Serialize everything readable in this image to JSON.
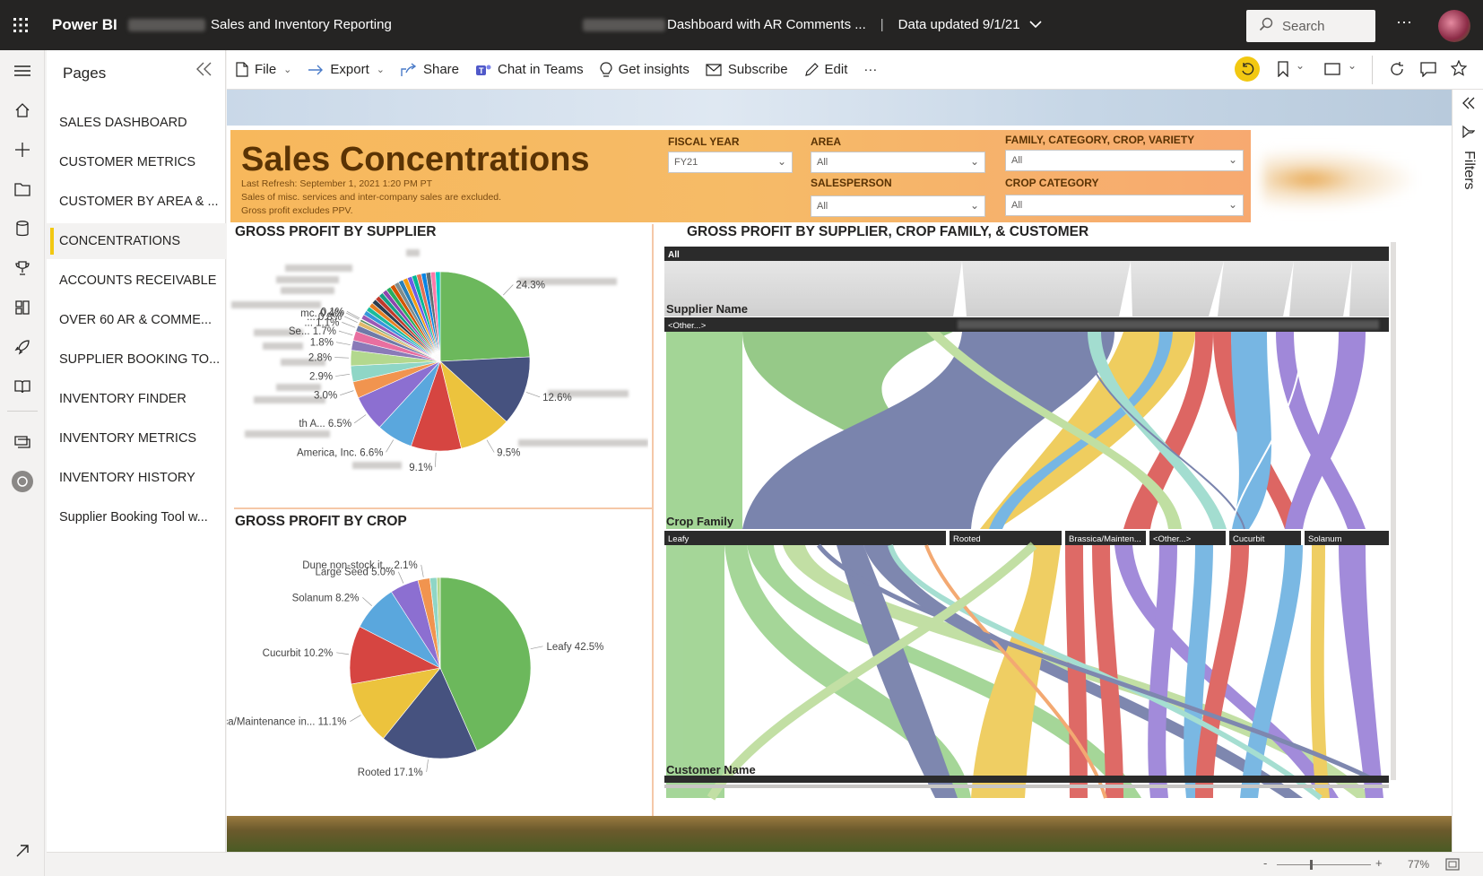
{
  "topbar": {
    "brand": "Power BI",
    "workspace": "Sales and Inventory Reporting",
    "report": "Dashboard with AR Comments ...",
    "separator": "|",
    "data_updated": "Data updated 9/1/21",
    "search_placeholder": "Search",
    "more": "···"
  },
  "pages_panel": {
    "title": "Pages",
    "items": [
      {
        "label": "SALES DASHBOARD",
        "active": false
      },
      {
        "label": "CUSTOMER METRICS",
        "active": false
      },
      {
        "label": "CUSTOMER BY AREA & ...",
        "active": false
      },
      {
        "label": "CONCENTRATIONS",
        "active": true
      },
      {
        "label": "ACCOUNTS RECEIVABLE",
        "active": false
      },
      {
        "label": "OVER 60 AR & COMME...",
        "active": false
      },
      {
        "label": "SUPPLIER BOOKING TO...",
        "active": false
      },
      {
        "label": "INVENTORY FINDER",
        "active": false
      },
      {
        "label": "INVENTORY METRICS",
        "active": false
      },
      {
        "label": "INVENTORY HISTORY",
        "active": false
      },
      {
        "label": "Supplier Booking Tool w...",
        "active": false
      }
    ]
  },
  "actionbar": {
    "file": "File",
    "export": "Export",
    "share": "Share",
    "chat": "Chat in Teams",
    "insights": "Get insights",
    "subscribe": "Subscribe",
    "edit": "Edit",
    "more": "···"
  },
  "report_header": {
    "title": "Sales Concentrations",
    "last_refresh": "Last Refresh: September 1, 2021 1:20 PM PT",
    "note1": "Sales of misc. services and inter-company sales are excluded.",
    "note2": "Gross profit excludes PPV."
  },
  "filters": {
    "fiscal_year_label": "FISCAL YEAR",
    "fiscal_year_value": "FY21",
    "area_label": "AREA",
    "area_value": "All",
    "salesperson_label": "SALESPERSON",
    "salesperson_value": "All",
    "family_label": "FAMILY, CATEGORY, CROP, VARIETY",
    "family_value": "All",
    "crop_category_label": "CROP CATEGORY",
    "crop_category_value": "All"
  },
  "visual_titles": {
    "by_supplier": "GROSS PROFIT BY SUPPLIER",
    "by_crop": "GROSS PROFIT BY CROP",
    "decomposition": "GROSS PROFIT BY SUPPLIER, CROP FAMILY, & CUSTOMER"
  },
  "chart_data": [
    {
      "type": "pie",
      "title": "GROSS PROFIT BY SUPPLIER",
      "slices": [
        {
          "label": "",
          "value": 24.3,
          "color": "#6cb85c"
        },
        {
          "label": "",
          "value": 12.6,
          "color": "#46527f"
        },
        {
          "label": "",
          "value": 9.5,
          "color": "#ecc33d"
        },
        {
          "label": "",
          "value": 9.1,
          "color": "#d64541"
        },
        {
          "label": "America, Inc.",
          "value": 6.6,
          "color": "#5aa7dd"
        },
        {
          "label": "th A...",
          "value": 6.5,
          "color": "#8c6fd1"
        },
        {
          "label": "",
          "value": 3.0,
          "color": "#f1944f"
        },
        {
          "label": "",
          "value": 2.9,
          "color": "#8fd6c6"
        },
        {
          "label": "",
          "value": 2.8,
          "color": "#b3d88e"
        },
        {
          "label": "",
          "value": 1.8,
          "color": "#8a7ab8"
        },
        {
          "label": "Se...",
          "value": 1.7,
          "color": "#e86fa0"
        },
        {
          "label": "...",
          "value": 1.1,
          "color": "#6f7aa8"
        },
        {
          "label": "...",
          "value": 0.8,
          "color": "#e2b96a"
        },
        {
          "label": "mc.",
          "value": 0.4,
          "color": "#5b8f61"
        },
        {
          "label": "",
          "value": 0.1,
          "color": "#a04560"
        }
      ],
      "other_value": 17.2
    },
    {
      "type": "pie",
      "title": "GROSS PROFIT BY CROP",
      "slices": [
        {
          "label": "Leafy",
          "value": 42.5,
          "color": "#6cb85c"
        },
        {
          "label": "Rooted",
          "value": 17.1,
          "color": "#46527f"
        },
        {
          "label": "Brassica/Maintenance in...",
          "value": 11.1,
          "color": "#ecc33d"
        },
        {
          "label": "Cucurbit",
          "value": 10.2,
          "color": "#d64541"
        },
        {
          "label": "Solanum",
          "value": 8.2,
          "color": "#5aa7dd"
        },
        {
          "label": "Large Seed",
          "value": 5.0,
          "color": "#8c6fd1"
        },
        {
          "label": "Dune non-stock it...",
          "value": 2.1,
          "color": "#f1944f"
        },
        {
          "label": "",
          "value": 1.2,
          "color": "#8fd6c6"
        },
        {
          "label": "",
          "value": 0.6,
          "color": "#b3d88e"
        }
      ]
    }
  ],
  "decomposition": {
    "root_label": "All",
    "level1": "Supplier Name",
    "level1_first": "<Other...>",
    "level2": "Crop Family",
    "level2_nodes": [
      "Leafy",
      "Rooted",
      "Brassica/Mainten...",
      "<Other...>",
      "Cucurbit",
      "Solanum"
    ],
    "level3": "Customer Name"
  },
  "filters_pane": {
    "label": "Filters"
  },
  "status": {
    "zoom": "77%",
    "minus": "-",
    "plus": "+"
  }
}
